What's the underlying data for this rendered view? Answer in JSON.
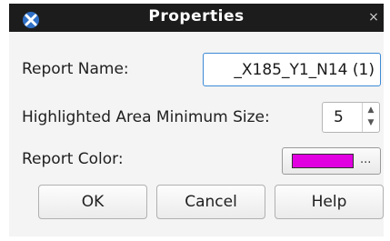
{
  "window": {
    "title": "Properties",
    "app_icon": "x-logo-icon",
    "close_glyph": "×"
  },
  "form": {
    "report_name": {
      "label": "Report Name:",
      "value": "_X185_Y1_N14 (1)"
    },
    "min_size": {
      "label": "Highlighted Area Minimum Size:",
      "value": "5",
      "up_glyph": "▲",
      "down_glyph": "▼"
    },
    "report_color": {
      "label": "Report Color:",
      "color": "#e000e0",
      "button_text": "..."
    }
  },
  "buttons": {
    "ok": "OK",
    "cancel": "Cancel",
    "help": "Help"
  }
}
